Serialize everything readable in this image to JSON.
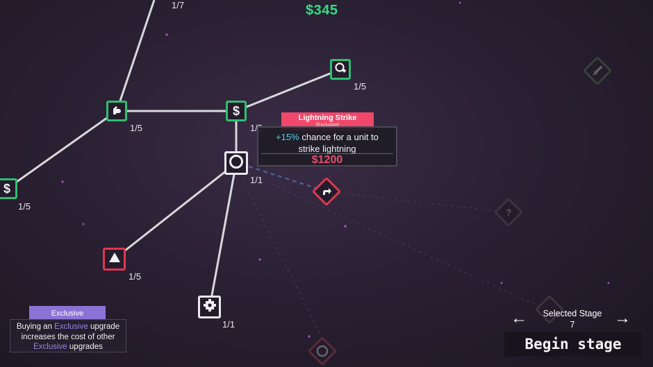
{
  "hud": {
    "money": "$345"
  },
  "nodes": [
    {
      "id": "top-left",
      "level": "1/7"
    },
    {
      "id": "fist",
      "level": "1/5",
      "icon": "fist-up-icon"
    },
    {
      "id": "dollar-center",
      "level": "1/5",
      "icon": "dollar-icon"
    },
    {
      "id": "search",
      "level": "1/5",
      "icon": "magnify-plus-icon"
    },
    {
      "id": "dollar-left",
      "level": "1/5",
      "icon": "dollar-icon"
    },
    {
      "id": "target",
      "level": "1/1",
      "icon": "ring-icon"
    },
    {
      "id": "triangle",
      "level": "1/5",
      "icon": "triangle-icon"
    },
    {
      "id": "gear",
      "level": "1/1",
      "icon": "gear-icon"
    },
    {
      "id": "redirect",
      "icon": "redirect-arrow-icon"
    },
    {
      "id": "locked-question",
      "icon": "question-icon"
    },
    {
      "id": "sword",
      "icon": "sword-icon"
    }
  ],
  "tooltip": {
    "title": "Lightning Strike",
    "tag": "[Exclusive]",
    "highlight": "+15%",
    "description": "chance for a unit to strike lightning",
    "price": "$1200"
  },
  "legend": {
    "badge": "Exclusive",
    "line1_pre": "Buying an",
    "line1_ex": "Exclusive",
    "line1_post": "upgrade",
    "line2": "increases the cost of other",
    "line3_ex": "Exclusive",
    "line3_post": "upgrades"
  },
  "stage": {
    "label": "Selected Stage",
    "number": "7",
    "prev": "←",
    "next": "→",
    "begin": "Begin stage"
  },
  "colors": {
    "owned": "#2fbf71",
    "exclusive": "#e0364f",
    "money": "#2ee080",
    "price": "#e8506c"
  }
}
